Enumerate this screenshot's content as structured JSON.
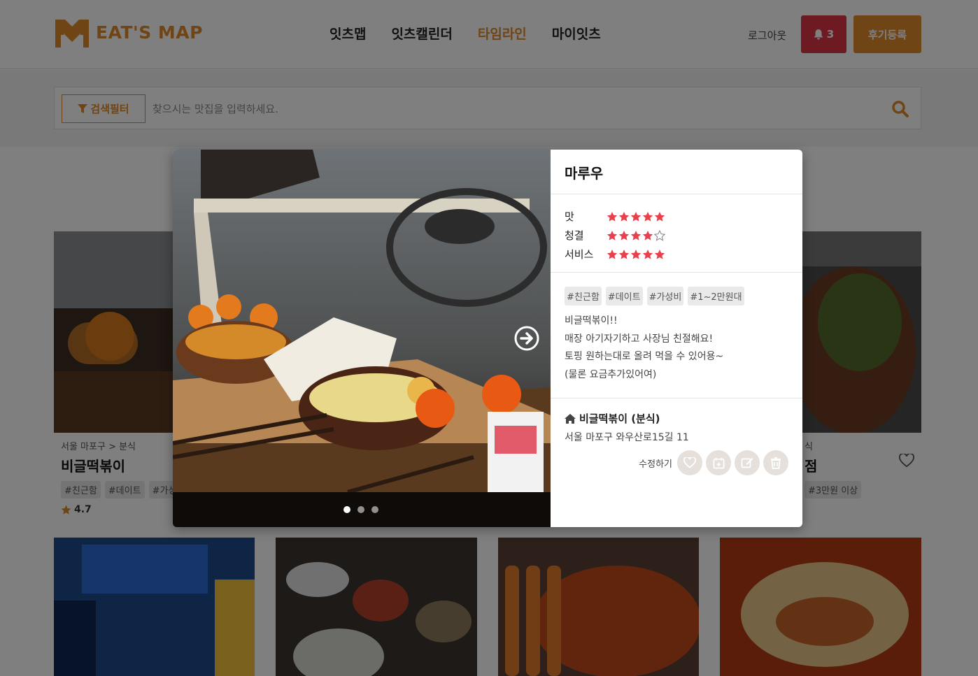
{
  "header": {
    "logo_text": "EAT'S MAP",
    "nav": [
      "잇츠맵",
      "잇츠캘린더",
      "타임라인",
      "마이잇츠"
    ],
    "active_nav": "타임라인",
    "logout": "로그아웃",
    "notifications_count": "3",
    "review_button": "후기등록"
  },
  "search": {
    "filter_label": "검색필터",
    "placeholder": "찾으시는 맛집을 입력하세요."
  },
  "cards": [
    {
      "crumb": "서울 마포구 > 분식",
      "title": "비글떡볶이",
      "tags": [
        "#친근함",
        "#데이트",
        "#가성"
      ],
      "rating": "4.7"
    },
    {
      "crumb": "식",
      "title": "점",
      "tags": [
        "#3만원 이상"
      ]
    }
  ],
  "modal": {
    "user": "마루우",
    "scores": [
      {
        "label": "맛",
        "stars": 5
      },
      {
        "label": "청결",
        "stars": 4
      },
      {
        "label": "서비스",
        "stars": 5
      }
    ],
    "tags": [
      "#친근함",
      "#데이트",
      "#가성비",
      "#1~2만원대"
    ],
    "description": [
      "비글떡볶이!!",
      "매장 아기자기하고 사장님 친절해요!",
      "토핑 원하는대로 올려 먹을 수 있어용~",
      "(물론 요금추가있어여)"
    ],
    "place_name": "비글떡볶이 (분식)",
    "place_address": "서울 마포구 와우산로15길 11",
    "edit_label": "수정하기",
    "photo_count": 3,
    "active_photo": 1
  },
  "colors": {
    "brand": "#e08a2a",
    "alert": "#dc3545",
    "star": "#e8414d"
  }
}
